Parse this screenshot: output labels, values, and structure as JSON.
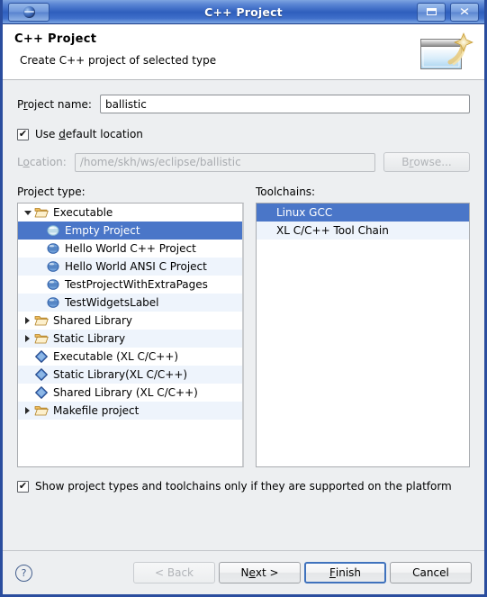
{
  "window": {
    "title": "C++ Project",
    "sys_menu_icon": "eclipse-globe-icon",
    "maximize_label": "",
    "close_label": "✕"
  },
  "banner": {
    "title": "C++ Project",
    "subtitle": "Create C++ project of selected type",
    "icon": "wizard-window-sparkle-icon"
  },
  "project_name": {
    "label": "Project name:",
    "label_pre": "P",
    "label_mnemonic": "r",
    "label_post": "oject name:",
    "value": "ballistic"
  },
  "use_default_location": {
    "label_pre": "Use ",
    "label_mnemonic": "d",
    "label_post": "efault location",
    "checked": true,
    "check_glyph": "✔"
  },
  "location": {
    "label_pre": "L",
    "label_mnemonic": "o",
    "label_post": "cation:",
    "value": "/home/skh/ws/eclipse/ballistic",
    "enabled": false,
    "browse_pre": "B",
    "browse_mnemonic": "r",
    "browse_post": "owse..."
  },
  "project_type": {
    "label": "Project type:",
    "items": [
      {
        "label": "Executable",
        "icon": "folder-open-icon",
        "indent": 0,
        "twisty": "down",
        "selected": false
      },
      {
        "label": "Empty Project",
        "icon": "sphere-icon",
        "indent": 1,
        "twisty": "none",
        "selected": true
      },
      {
        "label": "Hello World C++ Project",
        "icon": "sphere-icon",
        "indent": 1,
        "twisty": "none",
        "selected": false
      },
      {
        "label": "Hello World ANSI C Project",
        "icon": "sphere-icon",
        "indent": 1,
        "twisty": "none",
        "selected": false
      },
      {
        "label": "TestProjectWithExtraPages",
        "icon": "sphere-icon",
        "indent": 1,
        "twisty": "none",
        "selected": false
      },
      {
        "label": "TestWidgetsLabel",
        "icon": "sphere-icon",
        "indent": 1,
        "twisty": "none",
        "selected": false
      },
      {
        "label": "Shared Library",
        "icon": "folder-open-icon",
        "indent": 0,
        "twisty": "right",
        "selected": false
      },
      {
        "label": "Static Library",
        "icon": "folder-open-icon",
        "indent": 0,
        "twisty": "right",
        "selected": false
      },
      {
        "label": "Executable (XL C/C++)",
        "icon": "diamond-icon",
        "indent": 0,
        "twisty": "none",
        "selected": false
      },
      {
        "label": "Static Library(XL C/C++)",
        "icon": "diamond-icon",
        "indent": 0,
        "twisty": "none",
        "selected": false
      },
      {
        "label": "Shared Library (XL C/C++)",
        "icon": "diamond-icon",
        "indent": 0,
        "twisty": "none",
        "selected": false
      },
      {
        "label": "Makefile project",
        "icon": "folder-open-icon",
        "indent": 0,
        "twisty": "right",
        "selected": false
      }
    ]
  },
  "toolchains": {
    "label": "Toolchains:",
    "items": [
      {
        "label": "Linux GCC",
        "selected": true
      },
      {
        "label": "XL C/C++ Tool Chain",
        "selected": false
      }
    ]
  },
  "show_supported": {
    "label": "Show project types and toolchains only if they are supported on the platform",
    "checked": true,
    "check_glyph": "✔"
  },
  "buttons": {
    "help": "?",
    "back": "< Back",
    "back_enabled": false,
    "next_pre": "N",
    "next_mnemonic": "e",
    "next_post": "xt >",
    "finish_pre": "",
    "finish_mnemonic": "F",
    "finish_post": "inish",
    "cancel": "Cancel"
  },
  "colors": {
    "titlebar_blue": "#2f5fbd",
    "selection_blue": "#4a76c8",
    "row_stripe": "#eef4fc",
    "dialog_bg": "#edeff1",
    "default_button_border": "#3f72bd"
  }
}
